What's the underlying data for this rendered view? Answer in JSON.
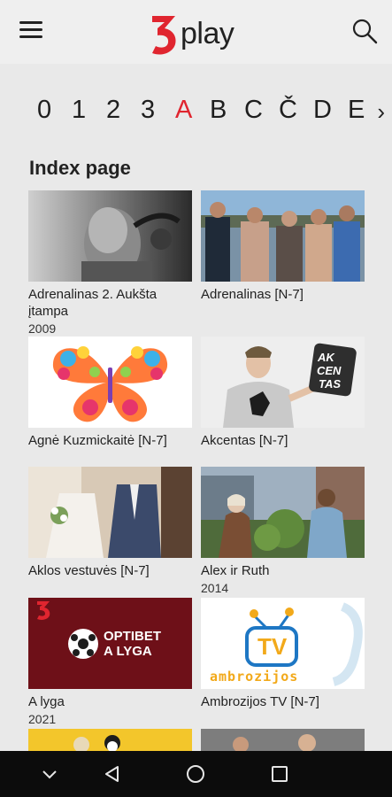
{
  "app": {
    "logo_text": "play",
    "logo_mark": "3"
  },
  "letters": [
    "0",
    "1",
    "2",
    "3",
    "A",
    "B",
    "C",
    "Č",
    "D",
    "E"
  ],
  "active_letter": "A",
  "page": {
    "heading": "Index page"
  },
  "items": [
    {
      "title": "Adrenalinas 2. Aukšta įtampa",
      "year": "2009",
      "icon": "action-still"
    },
    {
      "title": "Adrenalinas [N-7]",
      "year": "",
      "icon": "group-beach-photo"
    },
    {
      "title": "Agnė Kuzmickaitė [N-7]",
      "year": "",
      "icon": "butterfly-art"
    },
    {
      "title": "Akcentas [N-7]",
      "year": "",
      "icon": "man-with-sign"
    },
    {
      "title": "Aklos vestuvės [N-7]",
      "year": "",
      "icon": "wedding-photo"
    },
    {
      "title": "Alex ir Ruth",
      "year": "2014",
      "icon": "couple-balcony"
    },
    {
      "title": "A lyga",
      "year": "2021",
      "icon": "optibet-a-lyga"
    },
    {
      "title": "Ambrozijos TV [N-7]",
      "year": "",
      "icon": "ambrozijos-tv-logo"
    }
  ],
  "badges": {
    "optibet_line1": "OPTIBET",
    "optibet_line2": "A LYGA",
    "akcentas_sign": "AK CEN TAS",
    "ambro_tv": "TV",
    "ambro_word": "ambrozijos"
  },
  "colors": {
    "accent": "#e0252f",
    "background": "#e9e9e9",
    "navbar": "#0c0c0c"
  },
  "system_nav": [
    "back-chevron-icon",
    "back-triangle-icon",
    "home-circle-icon",
    "recents-square-icon"
  ]
}
